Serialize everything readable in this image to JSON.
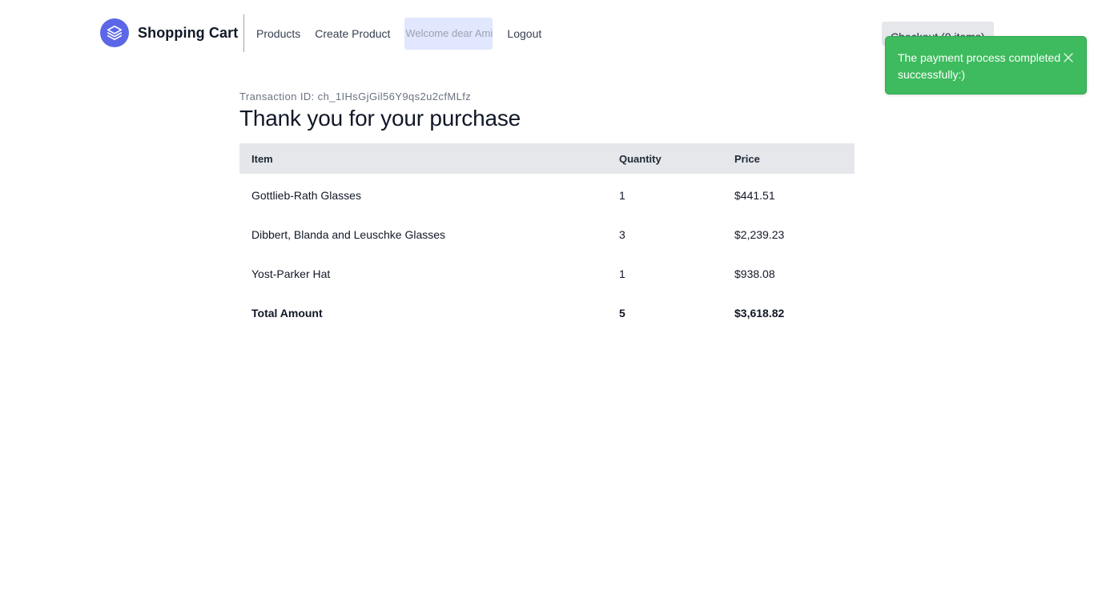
{
  "header": {
    "brand_title": "Shopping Cart",
    "nav": {
      "products": "Products",
      "create_product": "Create Product",
      "welcome": "Welcome dear Amir",
      "logout": "Logout"
    },
    "checkout_label": "Checkout (0 items)"
  },
  "toast": {
    "message": "The payment process completed successfully:)",
    "color": "#3dbb5e"
  },
  "main": {
    "transaction_id": "Transaction ID: ch_1IHsGjGil56Y9qs2u2cfMLfz",
    "title": "Thank you for your purchase",
    "table": {
      "headers": [
        "Item",
        "Quantity",
        "Price"
      ],
      "rows": [
        {
          "item": "Gottlieb-Rath Glasses",
          "quantity": "1",
          "price": "$441.51"
        },
        {
          "item": "Dibbert, Blanda and Leuschke Glasses",
          "quantity": "3",
          "price": "$2,239.23"
        },
        {
          "item": "Yost-Parker Hat",
          "quantity": "1",
          "price": "$938.08"
        }
      ],
      "total": {
        "label": "Total Amount",
        "quantity": "5",
        "price": "$3,618.82"
      }
    }
  },
  "colors": {
    "brand": "#5b67e6",
    "welcome_bg": "#e0e7ff",
    "table_header_bg": "#e5e7eb"
  },
  "icons": {
    "logo": "layers-icon",
    "toast_close": "close-icon"
  }
}
